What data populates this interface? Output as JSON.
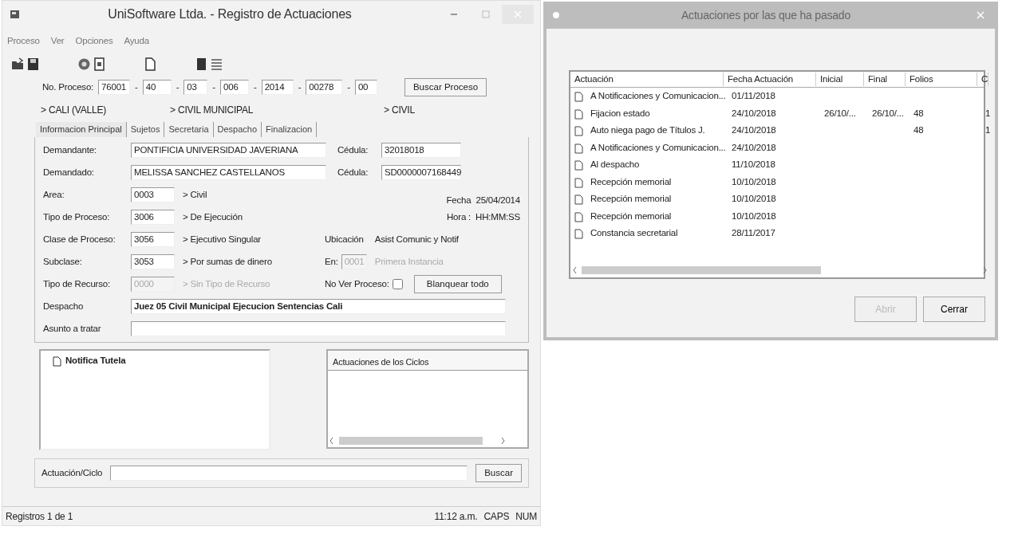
{
  "main_window": {
    "title": "UniSoftware Ltda. - Registro de Actuaciones",
    "menu": [
      "Proceso",
      "Ver",
      "Opciones",
      "Ayuda"
    ],
    "process_number": {
      "label": "No. Proceso:",
      "segments": [
        "76001",
        "40",
        "03",
        "006",
        "2014",
        "00278",
        "00"
      ],
      "separators": [
        "-",
        "-",
        "-",
        "-",
        "-",
        "-"
      ]
    },
    "search_button": "Buscar Proceso",
    "locations": [
      "> CALI (VALLE)",
      "> CIVIL MUNICIPAL",
      "> CIVIL"
    ],
    "tabs": [
      {
        "label": "Informacion Principal",
        "selected": true
      },
      {
        "label": "Sujetos",
        "selected": false
      },
      {
        "label": "Secretaria",
        "selected": false
      },
      {
        "label": "Despacho",
        "selected": false
      },
      {
        "label": "Finalizacion",
        "selected": false
      }
    ],
    "party_rows": [
      {
        "label": "Demandante:",
        "value": "PONTIFICIA UNIVERSIDAD JAVERIANA",
        "id_label": "Cédula:",
        "id_value": "32018018"
      },
      {
        "label": "Demandado:",
        "value": "MELISSA SANCHEZ CASTELLANOS",
        "id_label": "Cédula:",
        "id_value": "SD0000007168449"
      }
    ],
    "code_rows": [
      {
        "label": "Area:",
        "code": "0003",
        "description": "> Civil",
        "disabled": false
      },
      {
        "label": "Tipo de Proceso:",
        "code": "3006",
        "description": "> De Ejecución",
        "disabled": false
      },
      {
        "label": "Clase de Proceso:",
        "code": "3056",
        "description": "> Ejecutivo Singular",
        "disabled": false
      },
      {
        "label": "Subclase:",
        "code": "3053",
        "description": "> Por sumas de dinero",
        "disabled": false
      },
      {
        "label": "Tipo de Recurso:",
        "code": "0000",
        "description": "> Sin Tipo de Recurso",
        "disabled": true
      }
    ],
    "fecha": {
      "label": "Fecha",
      "value": "25/04/2014"
    },
    "hora": {
      "label": "Hora :",
      "value": "HH:MM:SS"
    },
    "ubicacion": {
      "label": "Ubicación",
      "value": "Asist Comunic y Notif"
    },
    "instancia": {
      "label": "En:",
      "code": "0001",
      "description": "Primera Instancia",
      "disabled": true
    },
    "no_ver_proceso": {
      "label": "No Ver Proceso:",
      "checked": false
    },
    "clear_button": "Blanquear todo",
    "despacho": {
      "label": "Despacho",
      "value": "Juez 05 Civil Municipal Ejecucion Sentencias Cali"
    },
    "asunto": {
      "label": "Asunto a tratar"
    },
    "tree": [
      {
        "label": "Notifica Tutela"
      }
    ],
    "cycles_panel": {
      "title": "Actuaciones de los Ciclos"
    },
    "search_row": {
      "label": "Actuación/Ciclo",
      "button": "Buscar"
    },
    "status_bar": {
      "records": "Registros 1 de 1",
      "time": "11:12 a.m.",
      "caps": "CAPS",
      "num": "NUM"
    }
  },
  "dialog": {
    "title": "Actuaciones por las que ha pasado",
    "table": {
      "columns": [
        "Actuación",
        "Fecha Actuación",
        "Inicial",
        "Final",
        "Folios",
        "C"
      ],
      "rows": [
        {
          "actuacion": "A Notificaciones y Comunicacion...",
          "fecha": "01/11/2018"
        },
        {
          "actuacion": "Fijacion estado",
          "fecha": "24/10/2018",
          "inicial": "26/10/...",
          "final": "26/10/...",
          "folios": "48",
          "column_6": "1"
        },
        {
          "actuacion": "Auto niega pago de Títulos J.",
          "fecha": "24/10/2018",
          "folios": "48",
          "column_6": "1"
        },
        {
          "actuacion": "A Notificaciones y Comunicacion...",
          "fecha": "24/10/2018"
        },
        {
          "actuacion": "Al despacho",
          "fecha": "11/10/2018"
        },
        {
          "actuacion": "Recepción memorial",
          "fecha": "10/10/2018"
        },
        {
          "actuacion": "Recepción memorial",
          "fecha": "10/10/2018"
        },
        {
          "actuacion": "Recepción memorial",
          "fecha": "10/10/2018"
        },
        {
          "actuacion": "Constancia secretarial",
          "fecha": "28/11/2017"
        }
      ]
    },
    "buttons": [
      {
        "label": "Abrir",
        "disabled": true
      },
      {
        "label": "Cerrar",
        "disabled": false
      }
    ]
  }
}
